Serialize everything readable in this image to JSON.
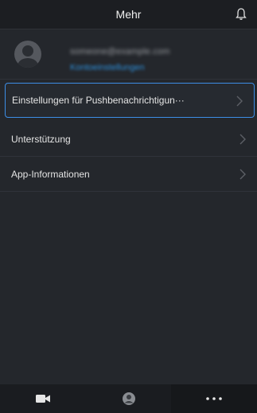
{
  "header": {
    "title": "Mehr",
    "bell_icon": "bell-icon"
  },
  "account": {
    "email": "someone@example.com",
    "settings_label": "Kontoeinstellungen",
    "avatar_icon": "avatar-placeholder-icon"
  },
  "menu": {
    "items": [
      {
        "label": "Einstellungen für Pushbenachrichtigun···",
        "selected": true,
        "icon": "chevron-right-icon"
      },
      {
        "label": "Unterstützung",
        "selected": false,
        "icon": "chevron-right-icon"
      },
      {
        "label": "App-Informationen",
        "selected": false,
        "icon": "chevron-right-icon"
      }
    ]
  },
  "bottom_nav": {
    "tabs": [
      {
        "icon": "video-camera-icon"
      },
      {
        "icon": "person-circle-icon"
      },
      {
        "icon": "more-dots-icon",
        "active": true
      }
    ]
  },
  "colors": {
    "accent": "#3d8ee6",
    "link": "#2e8ed8",
    "background": "#24272c"
  }
}
